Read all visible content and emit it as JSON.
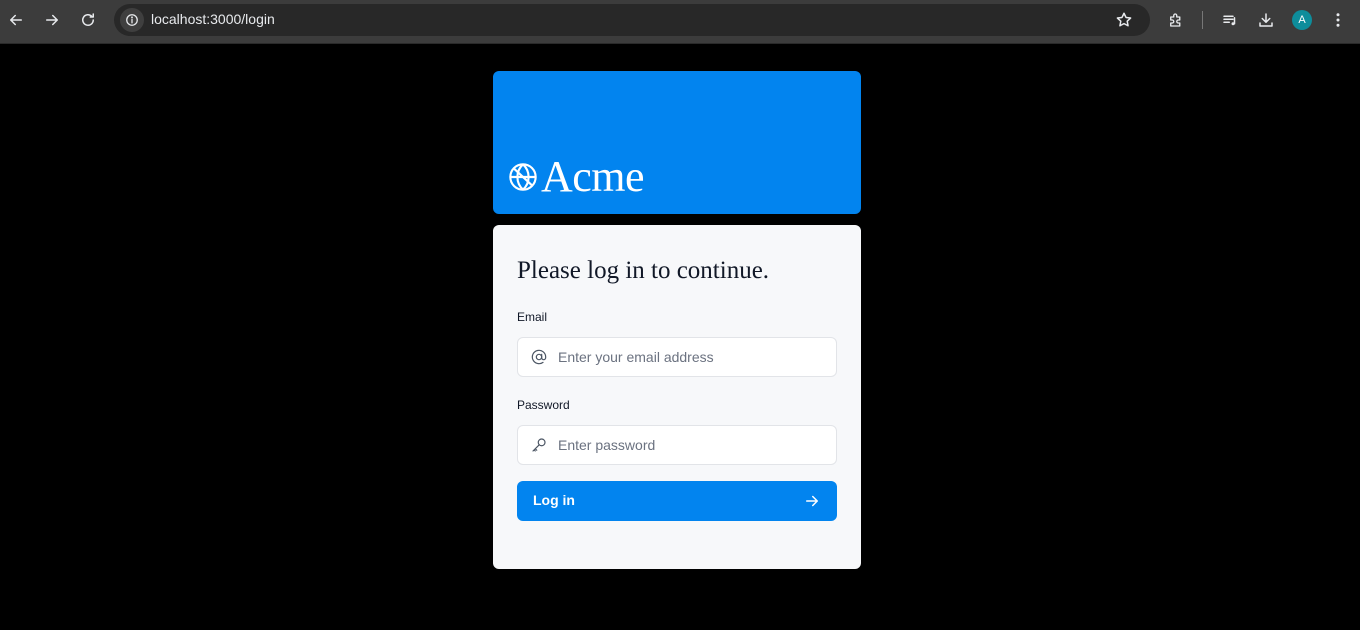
{
  "browser": {
    "url": "localhost:3000/login",
    "profile_initial": "A"
  },
  "banner": {
    "brand": "Acme",
    "brand_color": "#0284ef"
  },
  "login": {
    "heading": "Please log in to continue.",
    "email_label": "Email",
    "email_placeholder": "Enter your email address",
    "email_value": "",
    "password_label": "Password",
    "password_placeholder": "Enter password",
    "password_value": "",
    "submit_label": "Log in"
  },
  "icons": {
    "back": "arrow-left-icon",
    "forward": "arrow-right-icon",
    "reload": "reload-icon",
    "site_info": "info-icon",
    "bookmark": "star-icon",
    "extensions": "puzzle-icon",
    "media": "media-control-icon",
    "downloads": "download-icon",
    "menu": "kebab-menu-icon",
    "logo": "globe-icon",
    "email": "at-sign-icon",
    "password": "key-icon",
    "submit": "arrow-right-icon"
  }
}
